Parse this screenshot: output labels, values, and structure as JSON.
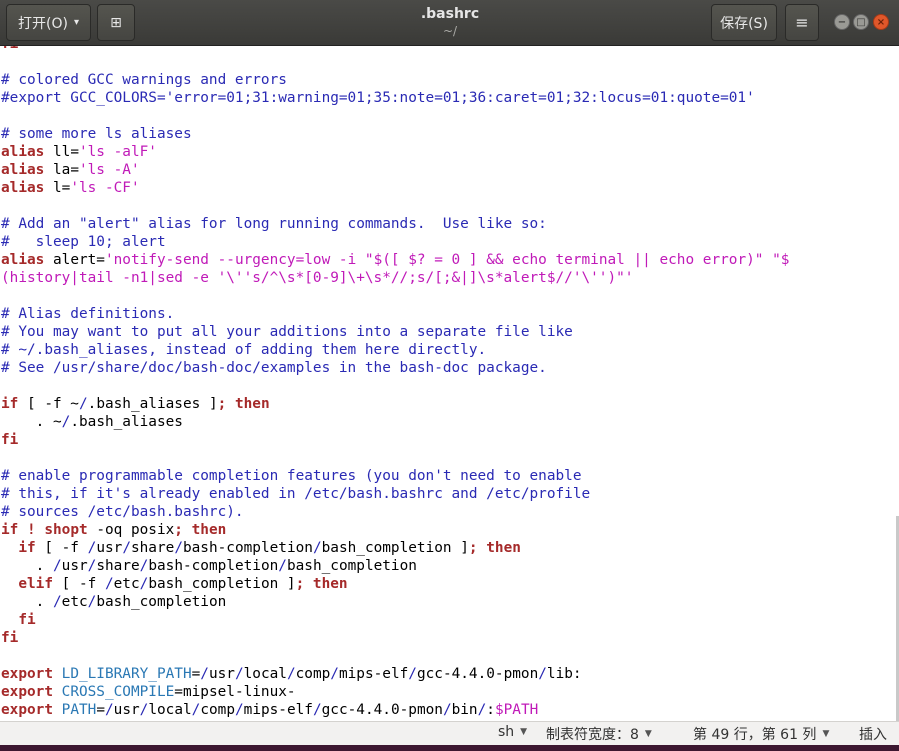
{
  "header": {
    "open_label": "打开(O)",
    "open_caret": "▾",
    "pin_icon_glyph": "⊞",
    "title": ".bashrc",
    "subtitle": "~/",
    "save_label": "保存(S)",
    "menu_icon_glyph": "≡",
    "min_glyph": "−",
    "max_glyph": "□",
    "close_glyph": "×"
  },
  "editor": {
    "language": "sh",
    "lines": [
      [
        [
          "kw",
          "fi"
        ]
      ],
      [],
      [
        [
          "cm",
          "# colored GCC warnings and errors"
        ]
      ],
      [
        [
          "cm",
          "#export GCC_COLORS='error=01;31:warning=01;35:note=01;36:caret=01;32:locus=01:quote=01'"
        ]
      ],
      [],
      [
        [
          "cm",
          "# some more ls aliases"
        ]
      ],
      [
        [
          "kw",
          "alias"
        ],
        [
          "t",
          " ll="
        ],
        [
          "st",
          "'ls -alF'"
        ]
      ],
      [
        [
          "kw",
          "alias"
        ],
        [
          "t",
          " la="
        ],
        [
          "st",
          "'ls -A'"
        ]
      ],
      [
        [
          "kw",
          "alias"
        ],
        [
          "t",
          " l="
        ],
        [
          "st",
          "'ls -CF'"
        ]
      ],
      [],
      [
        [
          "cm",
          "# Add an \"alert\" alias for long running commands.  Use like so:"
        ]
      ],
      [
        [
          "cm",
          "#   sleep 10; alert"
        ]
      ],
      [
        [
          "kw",
          "alias"
        ],
        [
          "t",
          " alert="
        ],
        [
          "st",
          "'notify-send --urgency=low -i \"$([ $? = 0 ] && echo terminal || echo error)\" \"$"
        ]
      ],
      [
        [
          "st",
          "(history|tail -n1|sed -e '\\''s/^\\s*[0-9]\\+\\s*//;s/[;&|]\\s*alert$//'\\'')\"'"
        ]
      ],
      [],
      [
        [
          "cm",
          "# Alias definitions."
        ]
      ],
      [
        [
          "cm",
          "# You may want to put all your additions into a separate file like"
        ]
      ],
      [
        [
          "cm",
          "# ~/.bash_aliases, instead of adding them here directly."
        ]
      ],
      [
        [
          "cm",
          "# See /usr/share/doc/bash-doc/examples in the bash-doc package."
        ]
      ],
      [],
      [
        [
          "kw",
          "if"
        ],
        [
          "t",
          " [ -f ~"
        ],
        [
          "pa",
          "/"
        ],
        [
          "t",
          ".bash_aliases ]"
        ],
        [
          "kw",
          "; then"
        ]
      ],
      [
        [
          "t",
          "    . ~"
        ],
        [
          "pa",
          "/"
        ],
        [
          "t",
          ".bash_aliases"
        ]
      ],
      [
        [
          "kw",
          "fi"
        ]
      ],
      [],
      [
        [
          "cm",
          "# enable programmable completion features (you don't need to enable"
        ]
      ],
      [
        [
          "cm",
          "# this, if it's already enabled in /etc/bash.bashrc and /etc/profile"
        ]
      ],
      [
        [
          "cm",
          "# sources /etc/bash.bashrc)."
        ]
      ],
      [
        [
          "kw",
          "if"
        ],
        [
          "t",
          " "
        ],
        [
          "kw",
          "! shopt"
        ],
        [
          "t",
          " -oq posix"
        ],
        [
          "kw",
          "; then"
        ]
      ],
      [
        [
          "t",
          "  "
        ],
        [
          "kw",
          "if"
        ],
        [
          "t",
          " [ -f "
        ],
        [
          "pa",
          "/"
        ],
        [
          "t",
          "usr"
        ],
        [
          "pa",
          "/"
        ],
        [
          "t",
          "share"
        ],
        [
          "pa",
          "/"
        ],
        [
          "t",
          "bash-completion"
        ],
        [
          "pa",
          "/"
        ],
        [
          "t",
          "bash_completion ]"
        ],
        [
          "kw",
          "; then"
        ]
      ],
      [
        [
          "t",
          "    . "
        ],
        [
          "pa",
          "/"
        ],
        [
          "t",
          "usr"
        ],
        [
          "pa",
          "/"
        ],
        [
          "t",
          "share"
        ],
        [
          "pa",
          "/"
        ],
        [
          "t",
          "bash-completion"
        ],
        [
          "pa",
          "/"
        ],
        [
          "t",
          "bash_completion"
        ]
      ],
      [
        [
          "t",
          "  "
        ],
        [
          "kw",
          "elif"
        ],
        [
          "t",
          " [ -f "
        ],
        [
          "pa",
          "/"
        ],
        [
          "t",
          "etc"
        ],
        [
          "pa",
          "/"
        ],
        [
          "t",
          "bash_completion ]"
        ],
        [
          "kw",
          "; then"
        ]
      ],
      [
        [
          "t",
          "    . "
        ],
        [
          "pa",
          "/"
        ],
        [
          "t",
          "etc"
        ],
        [
          "pa",
          "/"
        ],
        [
          "t",
          "bash_completion"
        ]
      ],
      [
        [
          "t",
          "  "
        ],
        [
          "kw",
          "fi"
        ]
      ],
      [
        [
          "kw",
          "fi"
        ]
      ],
      [],
      [
        [
          "kw",
          "export"
        ],
        [
          "t",
          " "
        ],
        [
          "vr",
          "LD_LIBRARY_PATH"
        ],
        [
          "t",
          "="
        ],
        [
          "pa",
          "/"
        ],
        [
          "t",
          "usr"
        ],
        [
          "pa",
          "/"
        ],
        [
          "t",
          "local"
        ],
        [
          "pa",
          "/"
        ],
        [
          "t",
          "comp"
        ],
        [
          "pa",
          "/"
        ],
        [
          "t",
          "mips-elf"
        ],
        [
          "pa",
          "/"
        ],
        [
          "t",
          "gcc-4.4.0-pmon"
        ],
        [
          "pa",
          "/"
        ],
        [
          "t",
          "lib:"
        ]
      ],
      [
        [
          "kw",
          "export"
        ],
        [
          "t",
          " "
        ],
        [
          "vr",
          "CROSS_COMPILE"
        ],
        [
          "t",
          "=mipsel-linux-"
        ]
      ],
      [
        [
          "kw",
          "export"
        ],
        [
          "t",
          " "
        ],
        [
          "vr",
          "PATH"
        ],
        [
          "t",
          "="
        ],
        [
          "pa",
          "/"
        ],
        [
          "t",
          "usr"
        ],
        [
          "pa",
          "/"
        ],
        [
          "t",
          "local"
        ],
        [
          "pa",
          "/"
        ],
        [
          "t",
          "comp"
        ],
        [
          "pa",
          "/"
        ],
        [
          "t",
          "mips-elf"
        ],
        [
          "pa",
          "/"
        ],
        [
          "t",
          "gcc-4.4.0-pmon"
        ],
        [
          "pa",
          "/"
        ],
        [
          "t",
          "bin"
        ],
        [
          "pa",
          "/"
        ],
        [
          "t",
          ":"
        ],
        [
          "st",
          "$PATH"
        ]
      ]
    ]
  },
  "statusbar": {
    "language": "sh",
    "tab_width": "制表符宽度：8",
    "position": "第 49 行，第 61 列",
    "mode": "插入",
    "dropdown_glyph": "▼"
  }
}
